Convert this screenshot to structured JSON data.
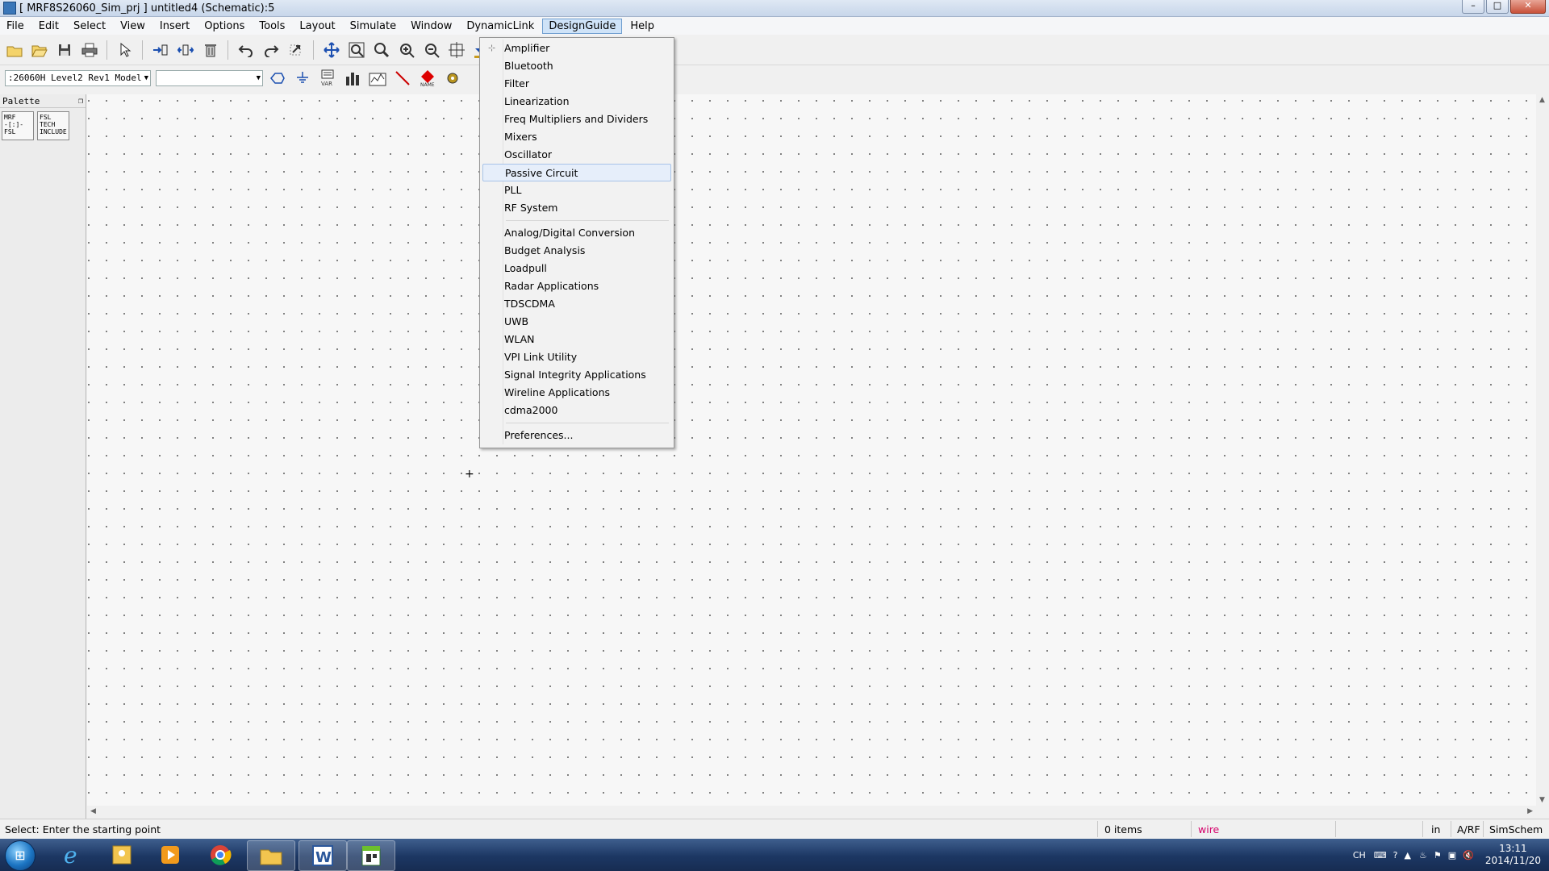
{
  "window": {
    "title": "[ MRF8S26060_Sim_prj ] untitled4 (Schematic):5",
    "minimize": "–",
    "maximize": "□",
    "close": "✕"
  },
  "menubar": {
    "items": [
      "File",
      "Edit",
      "Select",
      "View",
      "Insert",
      "Options",
      "Tools",
      "Layout",
      "Simulate",
      "Window",
      "DynamicLink",
      "DesignGuide",
      "Help"
    ],
    "active": "DesignGuide"
  },
  "toolbar2": {
    "library_combo": ":26060H Level2 Rev1 Model",
    "component_combo": ""
  },
  "palette": {
    "title": "Palette",
    "tiles": [
      {
        "label": "MRF\n-[:]-\nFSL"
      },
      {
        "label": "FSL\nTECH\nINCLUDE"
      }
    ]
  },
  "designguide_menu": {
    "group1": [
      "Amplifier",
      "Bluetooth",
      "Filter",
      "Linearization",
      "Freq Multipliers and Dividers",
      "Mixers",
      "Oscillator",
      "Passive Circuit",
      "PLL",
      "RF System"
    ],
    "group2": [
      "Analog/Digital Conversion",
      "Budget Analysis",
      "Loadpull",
      "Radar Applications",
      "TDSCDMA",
      "UWB",
      "WLAN",
      "VPI Link Utility",
      "Signal Integrity Applications",
      "Wireline Applications",
      "cdma2000"
    ],
    "group3": [
      "Preferences..."
    ],
    "highlighted": "Passive Circuit"
  },
  "statusbar": {
    "message": "Select: Enter the starting point",
    "items_count": "0 items",
    "mode": "wire",
    "mode_color": "#d4006a",
    "units": "in",
    "domain": "A/RF",
    "simulator": "SimSchem"
  },
  "taskbar": {
    "tray_lang": "CH",
    "time": "13:11",
    "date": "2014/11/20"
  }
}
